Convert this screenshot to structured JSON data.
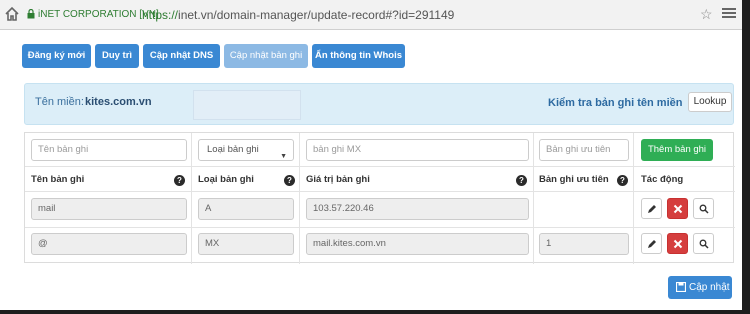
{
  "browser": {
    "cert": "iNET CORPORATION [VN]",
    "url_scheme": "https://",
    "url_rest": "inet.vn/domain-manager/update-record#?id=291149"
  },
  "tabs": [
    {
      "label": "Đăng ký mới"
    },
    {
      "label": "Duy trì"
    },
    {
      "label": "Cập nhật DNS"
    },
    {
      "label": "Cập nhật bản ghi"
    },
    {
      "label": "Ẩn thông tin Whois"
    }
  ],
  "domain": {
    "label": "Tên miền:",
    "value": "kites.com.vn",
    "check_label": "Kiểm tra bản ghi tên miền",
    "lookup_label": "Lookup"
  },
  "form": {
    "name_placeholder": "Tên bản ghi",
    "type_label": "Loại bản ghi",
    "value_placeholder": "bản ghi MX",
    "priority_placeholder": "Bản ghi ưu tiên",
    "add_label": "Thêm bản ghi"
  },
  "headers": {
    "name": "Tên bản ghi",
    "type": "Loại bản ghi",
    "value": "Giá trị bản ghi",
    "priority": "Bản ghi ưu tiên",
    "action": "Tác động"
  },
  "rows": [
    {
      "name": "mail",
      "type": "A",
      "value": "103.57.220.46",
      "priority": ""
    },
    {
      "name": "@",
      "type": "MX",
      "value": "mail.kites.com.vn",
      "priority": "1"
    }
  ],
  "footer": {
    "update_label": "Cập nhật"
  }
}
